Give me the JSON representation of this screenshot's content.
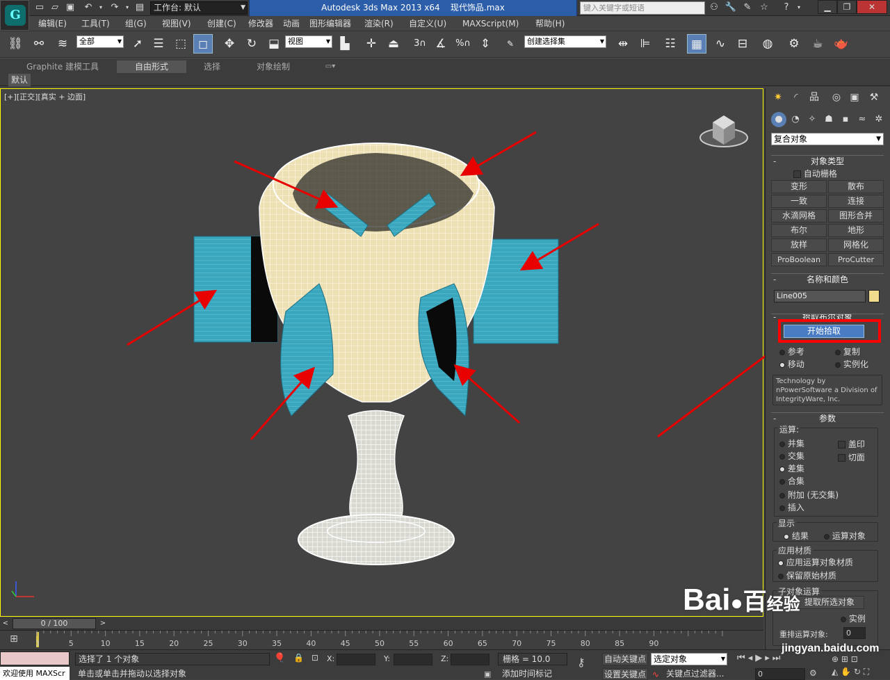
{
  "titlebar": {
    "workspace_label": "工作台: 默认",
    "app_title": "Autodesk 3ds Max  2013 x64",
    "file_name": "现代饰品.max",
    "search_placeholder": "键入关键字或短语"
  },
  "menubar": {
    "items": [
      "编辑(E)",
      "工具(T)",
      "组(G)",
      "视图(V)",
      "创建(C)",
      "修改器",
      "动画",
      "图形编辑器",
      "渲染(R)",
      "自定义(U)",
      "MAXScript(M)",
      "帮助(H)"
    ]
  },
  "toolbar": {
    "selection_filter": "全部",
    "ref_coord": "视图",
    "named_selection": "创建选择集",
    "snap_angle_label": "3",
    "percent_snap_label": "%"
  },
  "ribbon": {
    "tabs": [
      "Graphite 建模工具",
      "自由形式",
      "选择",
      "对象绘制"
    ],
    "sub_label": "默认"
  },
  "viewport": {
    "label_bracket_plus": "[+]",
    "label_view": "[正交]",
    "label_shading": "[真实 + 边面]"
  },
  "command_panel": {
    "category": "复合对象",
    "object_type": {
      "header": "对象类型",
      "autogrid": "自动栅格",
      "buttons": [
        "变形",
        "散布",
        "一致",
        "连接",
        "水滴网格",
        "图形合并",
        "布尔",
        "地形",
        "放样",
        "网格化",
        "ProBoolean",
        "ProCutter"
      ]
    },
    "name_color": {
      "header": "名称和颜色",
      "name_value": "Line005",
      "color": "#f0dc8c"
    },
    "pick": {
      "header": "拾取布尔对象",
      "start_pick": "开始拾取",
      "options": [
        "参考",
        "复制",
        "移动",
        "实例化"
      ],
      "credits": "Technology by nPowerSoftware a Division of IntegrityWare, Inc."
    },
    "params": {
      "header": "参数",
      "ops_label": "运算:",
      "ops": [
        "并集",
        "交集",
        "差集",
        "合集",
        "附加 (无交集)",
        "插入"
      ],
      "selected_op": "差集",
      "imprint": "盖印",
      "cookie": "切面",
      "display_label": "显示",
      "display_options": [
        "结果",
        "运算对象"
      ],
      "apply_material_label": "应用材质",
      "material_options": [
        "应用运算对象材质",
        "保留原始材质"
      ],
      "subobj_label": "子对象运算",
      "extract_btn": "提取所选对象",
      "extract_instance": "实例",
      "reorder_label": "重排运算对象:",
      "reorder_value": "0"
    }
  },
  "timeline": {
    "frame_label": "0 / 100",
    "ticks": [
      "0",
      "5",
      "10",
      "15",
      "20",
      "25",
      "30",
      "35",
      "40",
      "45",
      "50",
      "55",
      "60",
      "65",
      "70",
      "75",
      "80",
      "85",
      "90"
    ]
  },
  "statusbar": {
    "welcome": "欢迎使用 MAXScr",
    "selected_info": "选择了 1 个对象",
    "prompt": "单击或单击并拖动以选择对象",
    "x_label": "X:",
    "y_label": "Y:",
    "z_label": "Z:",
    "grid_label": "栅格 = 10.0",
    "add_time_tag": "添加时间标记",
    "auto_key": "自动关键点",
    "set_key": "设置关键点",
    "selected_object": "选定对象",
    "key_filters": "关键点过滤器...",
    "frame_value": "0"
  },
  "watermark": {
    "brand": "Bai",
    "brand_suffix": "百",
    "brand_suffix2": "经验",
    "url": "jingyan.baidu.com"
  },
  "accent_colors": {
    "highlight_box": "#ff0000",
    "arrow": "#e80000",
    "title_blue": "#2b5da8"
  }
}
